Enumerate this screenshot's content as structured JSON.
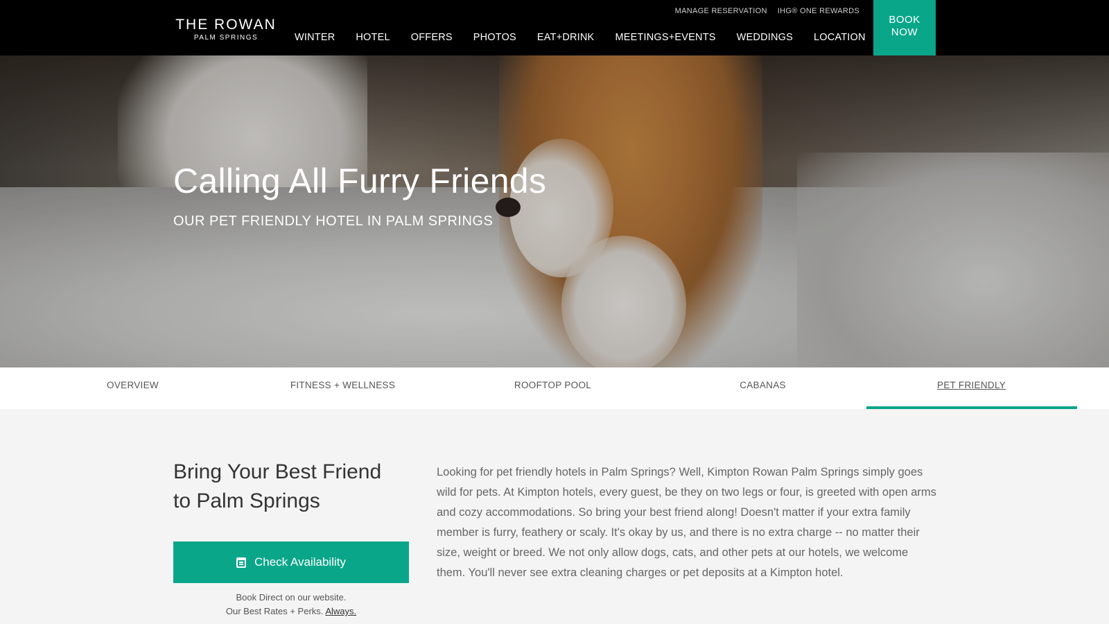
{
  "header": {
    "logo_main": "THE ROWAN",
    "logo_sub": "PALM SPRINGS",
    "utility_links": [
      "MANAGE RESERVATION",
      "IHG® ONE REWARDS"
    ],
    "nav": [
      "WINTER",
      "HOTEL",
      "OFFERS",
      "PHOTOS",
      "EAT+DRINK",
      "MEETINGS+EVENTS",
      "WEDDINGS",
      "LOCATION"
    ],
    "book_line1": "BOOK",
    "book_line2": "NOW"
  },
  "hero": {
    "title": "Calling All Furry Friends",
    "subtitle": "OUR PET FRIENDLY HOTEL IN PALM SPRINGS"
  },
  "tabs": [
    "OVERVIEW",
    "FITNESS + WELLNESS",
    "ROOFTOP POOL",
    "CABANAS",
    "PET FRIENDLY"
  ],
  "active_tab": "PET FRIENDLY",
  "intro": {
    "title_line1": "Bring Your Best Friend",
    "title_line2": "to Palm Springs",
    "button": "Check Availability",
    "note_line1": "Book Direct on our website.",
    "note_line2": "Our Best Rates + Perks.",
    "note_link": "Always."
  },
  "body": "Looking for pet friendly hotels in Palm Springs? Well, Kimpton Rowan Palm Springs simply goes wild for pets. At Kimpton hotels, every guest, be they on two legs or four, is greeted with open arms and cozy accommodations. So bring your best friend along! Doesn't matter if your extra family member is furry, feathery or scaly. It's okay by us, and there is no extra charge -- no matter their size, weight or breed. We not only allow dogs, cats, and other pets at our hotels, we welcome them. You'll never see extra cleaning charges or pet deposits at a Kimpton hotel.",
  "colors": {
    "accent": "#0aa68a",
    "header_bg": "#000000",
    "page_bg": "#f4f4f4"
  },
  "icons": {
    "check_availability": "calendar-icon"
  }
}
